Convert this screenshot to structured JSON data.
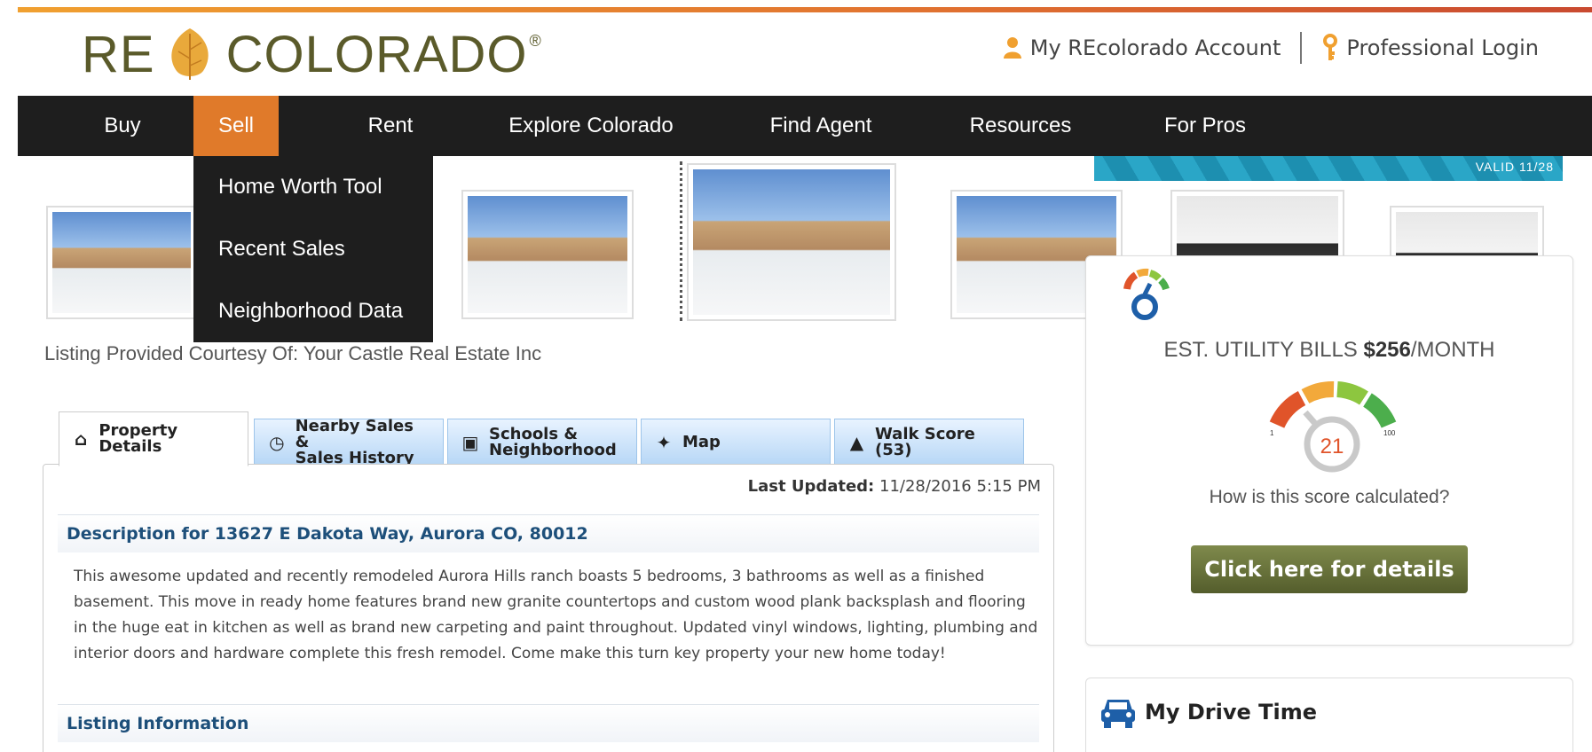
{
  "brand": {
    "logo_left": "RE",
    "logo_right": "COLORADO",
    "logo_mark": "®"
  },
  "header": {
    "account_label": "My REcolorado Account",
    "pro_login_label": "Professional Login"
  },
  "nav": {
    "items": [
      "Buy",
      "Sell",
      "Rent",
      "Explore Colorado",
      "Find Agent",
      "Resources",
      "For Pros"
    ],
    "active": "Sell"
  },
  "sell_menu": [
    "Home Worth Tool",
    "Recent Sales",
    "Neighborhood Data"
  ],
  "banner": {
    "valid_text": "VALID 11/28"
  },
  "courtesy": "Listing Provided Courtesy Of: Your Castle Real Estate Inc",
  "tabs": [
    {
      "label": "Property Details",
      "icon": "home-icon"
    },
    {
      "label_line1": "Nearby Sales &",
      "label_line2": "Sales History",
      "icon": "clock-icon"
    },
    {
      "label_line1": "Schools &",
      "label_line2": "Neighborhood",
      "icon": "bar-chart-icon"
    },
    {
      "label": "Map",
      "icon": "compass-icon"
    },
    {
      "label": "Walk Score (53)",
      "icon": "road-icon"
    }
  ],
  "details": {
    "last_updated_label": "Last Updated:",
    "last_updated_value": "11/28/2016 5:15 PM",
    "description_heading": "Description for 13627 E Dakota Way,  Aurora CO, 80012",
    "description": "This awesome updated and recently remodeled Aurora Hills ranch boasts 5 bedrooms, 3 bathrooms as well as a finished basement. This move in ready home features brand new granite countertops and custom wood plank backsplash and flooring in the huge eat in kitchen as well as brand new carpeting and paint throughout. Updated vinyl windows, lighting, plumbing and interior doors and hardware complete this fresh remodel. Come make this turn key property your new home today!",
    "listing_info_heading": "Listing Information"
  },
  "utility": {
    "title_prefix": "EST. UTILITY BILLS ",
    "amount": "$256",
    "title_suffix": "/MONTH",
    "gauge_min": "1",
    "gauge_max": "100",
    "score": "21",
    "score_link": "How is this score calculated?",
    "button_label": "Click here for details",
    "colors": [
      "#e0542a",
      "#f2a93b",
      "#8dc63f",
      "#4cae4c"
    ]
  },
  "drive": {
    "title": "My Drive Time"
  }
}
